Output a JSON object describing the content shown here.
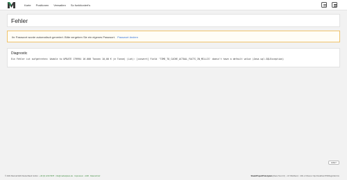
{
  "nav": {
    "items": [
      "Karte",
      "Positionen",
      "Verwalten",
      "So funktioniert's"
    ]
  },
  "icons": {
    "logo": "logo-icon",
    "top_right": [
      "user-card-icon",
      "menu-icon"
    ]
  },
  "page": {
    "title": "Fehler"
  },
  "warning": {
    "text": "Ihr Passwort wurde automatisch generiert. Bitte vergeben Sie ein eigenes Passwort.",
    "link": "Passwort ändern"
  },
  "diagnostic": {
    "title": "Diagnostic",
    "message": "Ein Fehler ist aufgetreten: Unable to UPDATE 179994 16.000 Tonnen 10,00 € je Tonne) (Lot): [convert] Field 'TIME_TO_CACHE_ACTUAL_FACTS_IN_MILLIS' doesn't have a default value (Java.sql.SQLException)"
  },
  "help_button": "Hilfe?",
  "footer": {
    "left_text": "© 2021 Marmal Mehl Deutschland GmbH ·",
    "left_links": "+49 (0) 1234 5678 · info@marketplace.de · Impressum · AGB · Datenschutz",
    "right_bold": "StaatsProjectPrototyaten",
    "right_text": "(Dace Test 2.0) · v17.09c20am1 · URL of iFrame: http://localhost:8700/login/list.htm"
  },
  "colors": {
    "accent_link": "#3b78d8",
    "warning_border": "#f0c36b",
    "footer_link": "#3a8a3a",
    "logo_green": "#2e8b57"
  }
}
